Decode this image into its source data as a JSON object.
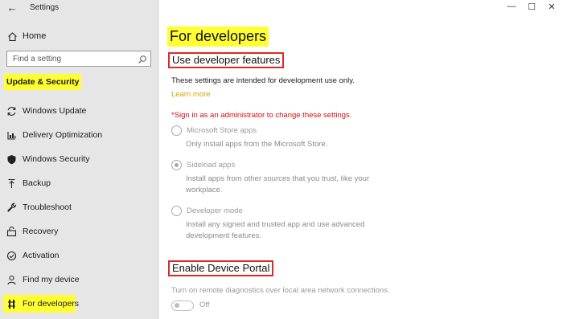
{
  "window": {
    "title": "Settings"
  },
  "sidebar": {
    "home": "Home",
    "search_placeholder": "Find a setting",
    "section": "Update & Security",
    "items": [
      {
        "label": "Windows Update",
        "icon": "sync-icon"
      },
      {
        "label": "Delivery Optimization",
        "icon": "delivery-optimization-icon"
      },
      {
        "label": "Windows Security",
        "icon": "shield-icon"
      },
      {
        "label": "Backup",
        "icon": "backup-arrow-icon"
      },
      {
        "label": "Troubleshoot",
        "icon": "wrench-icon"
      },
      {
        "label": "Recovery",
        "icon": "recovery-icon"
      },
      {
        "label": "Activation",
        "icon": "checkmark-circle-icon"
      },
      {
        "label": "Find my device",
        "icon": "person-pin-icon"
      },
      {
        "label": "For developers",
        "icon": "developer-tools-icon",
        "active": true
      }
    ]
  },
  "main": {
    "title": "For developers",
    "dev_features": {
      "heading": "Use developer features",
      "description": "These settings are intended for development use only.",
      "learn_more": "Learn more",
      "admin_warning": "*Sign in as an administrator to change these settings.",
      "options": [
        {
          "label": "Microsoft Store apps",
          "description": [
            "Only install apps from the Microsoft Store."
          ],
          "checked": false
        },
        {
          "label": "Sideload apps",
          "description": [
            "Install apps from other sources that you trust, like your",
            "workplace."
          ],
          "checked": true
        },
        {
          "label": "Developer mode",
          "description": [
            "Install any signed and trusted app and use advanced",
            "development features."
          ],
          "checked": false
        }
      ]
    },
    "device_portal": {
      "heading": "Enable Device Portal",
      "description": "Turn on remote diagnostics over local area network connections.",
      "toggle_state": "Off"
    }
  },
  "colors": {
    "highlight": "#ffff33",
    "callout_border": "#e02828",
    "link": "#e0a000",
    "warning": "#d01010"
  }
}
